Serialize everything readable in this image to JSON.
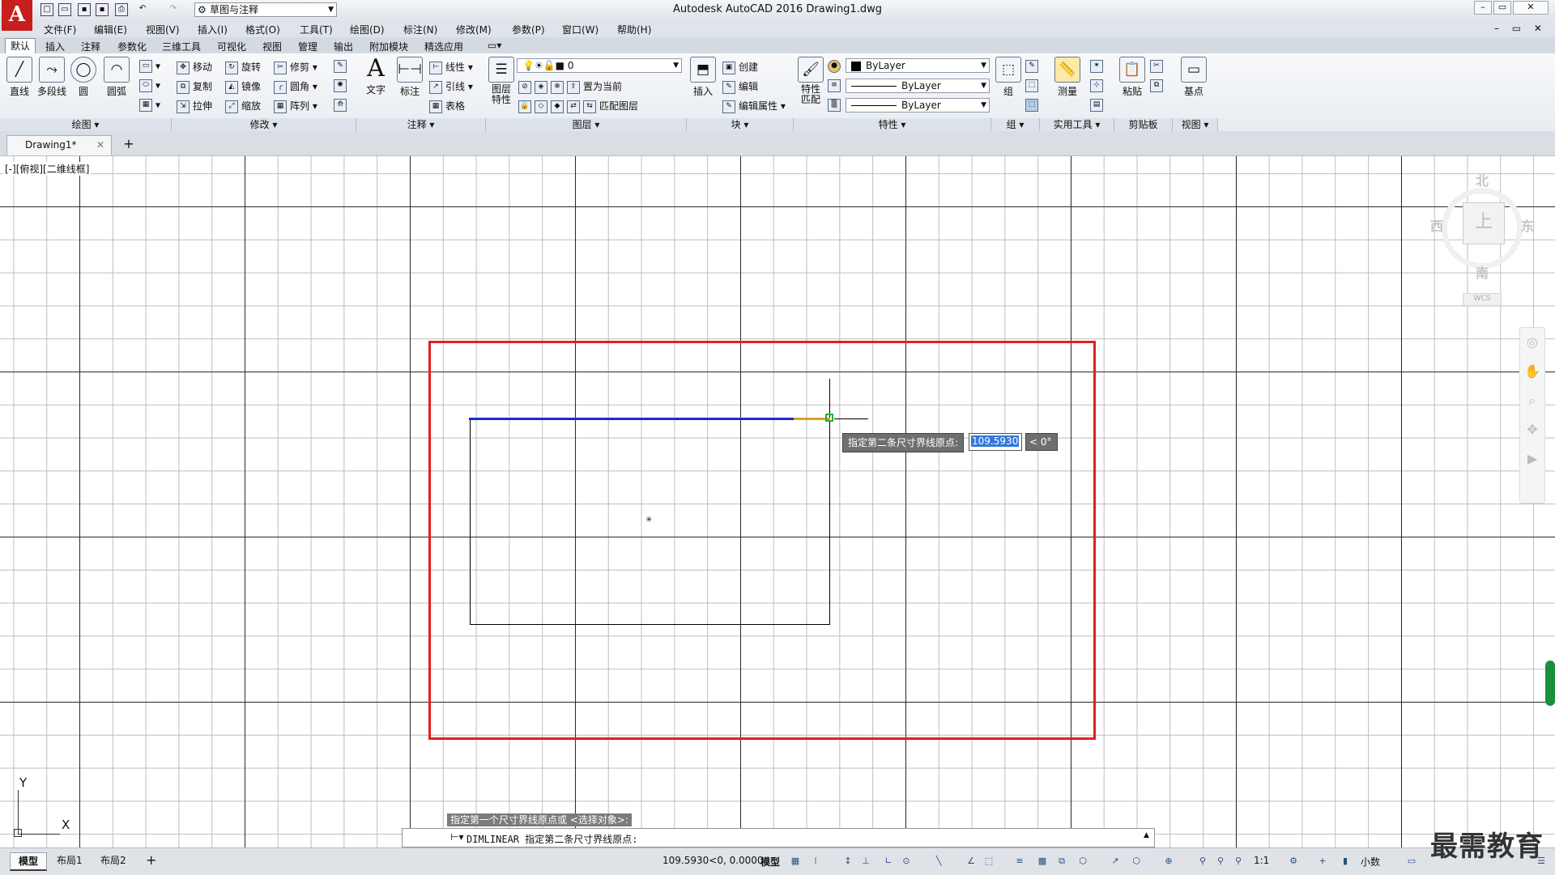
{
  "title_bar": {
    "app_title": "Autodesk AutoCAD 2016    Drawing1.dwg",
    "workspace": "草图与注释",
    "logo": "A"
  },
  "menu": [
    "文件(F)",
    "编辑(E)",
    "视图(V)",
    "插入(I)",
    "格式(O)",
    "工具(T)",
    "绘图(D)",
    "标注(N)",
    "修改(M)",
    "参数(P)",
    "窗口(W)",
    "帮助(H)"
  ],
  "ribbon_tabs": [
    "默认",
    "插入",
    "注释",
    "参数化",
    "三维工具",
    "可视化",
    "视图",
    "管理",
    "输出",
    "附加模块",
    "精选应用"
  ],
  "ribbon": {
    "draw": {
      "line": "直线",
      "polyline": "多段线",
      "circle": "圆",
      "arc": "圆弧",
      "title": "绘图 ▾"
    },
    "modify": {
      "move": "移动",
      "rotate": "旋转",
      "trim": "修剪",
      "copy": "复制",
      "mirror": "镜像",
      "fillet": "圆角",
      "stretch": "拉伸",
      "scale": "缩放",
      "array": "阵列",
      "title": "修改 ▾"
    },
    "annotation": {
      "text": "文字",
      "dimension": "标注",
      "linear": "线性",
      "leader": "引线",
      "table": "表格",
      "title": "注释 ▾"
    },
    "layers": {
      "layer_props": "图层\n特性",
      "current_layer": "0",
      "set_current": "置为当前",
      "match_layer": "匹配图层",
      "title": "图层 ▾"
    },
    "block": {
      "insert": "插入",
      "create": "创建",
      "edit": "编辑",
      "edit_attr": "编辑属性",
      "title": "块 ▾"
    },
    "properties": {
      "match": "特性\n匹配",
      "color": "ByLayer",
      "linetype": "ByLayer",
      "lineweight": "ByLayer",
      "title": "特性 ▾"
    },
    "groups": {
      "group": "组",
      "title": "组 ▾"
    },
    "utilities": {
      "measure": "测量",
      "title": "实用工具 ▾"
    },
    "clipboard": {
      "paste": "粘贴",
      "title": "剪贴板"
    },
    "view": {
      "base": "基点",
      "title": "视图 ▾"
    }
  },
  "file_tab": {
    "name": "Drawing1*",
    "close": "✕",
    "new": "+"
  },
  "viewport_label": "[-][俯视][二维线框]",
  "viewcube": {
    "north": "北",
    "south": "南",
    "east": "东",
    "west": "西",
    "top": "上",
    "wcs": "WCS"
  },
  "dynamic_input": {
    "prompt": "指定第二条尺寸界线原点:",
    "value": "109.5930",
    "angle": "< 0°"
  },
  "ucs": {
    "x": "X",
    "y": "Y"
  },
  "command": {
    "history": "指定第一个尺寸界线原点或 <选择对象>:",
    "current": "DIMLINEAR 指定第二条尺寸界线原点:"
  },
  "layout_tabs": [
    "模型",
    "布局1",
    "布局2"
  ],
  "status": {
    "coords": "109.5930<0, 0.0000",
    "model": "模型",
    "scale": "1:1",
    "units": "小数"
  },
  "watermark": "最需教育",
  "colors": {
    "selection": "#e02020",
    "dimension_line": "#1c2bd0",
    "snap_marker": "#23b030",
    "logo": "#c81e1e"
  }
}
